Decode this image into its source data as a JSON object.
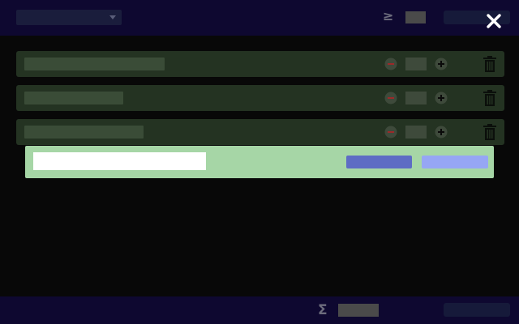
{
  "header": {
    "filter_select": {
      "value": ""
    },
    "threshold_icon": "greater-equal-icon",
    "threshold_value": "",
    "action_label": "",
    "close_icon": "close-icon"
  },
  "items": [
    {
      "name": "",
      "quantity": ""
    },
    {
      "name": "",
      "quantity": ""
    },
    {
      "name": "",
      "quantity": ""
    }
  ],
  "add_bar": {
    "input_value": "",
    "input_placeholder": "",
    "primary_label": "",
    "secondary_label": ""
  },
  "footer": {
    "total_icon": "sigma-icon",
    "total_value": "",
    "action_label": ""
  },
  "colors": {
    "header_bg": "#0e0830",
    "row_bg": "#243322",
    "add_bar_bg": "#a6d6a6",
    "primary_button": "#5e6cc4",
    "secondary_button": "#96a6f4"
  }
}
